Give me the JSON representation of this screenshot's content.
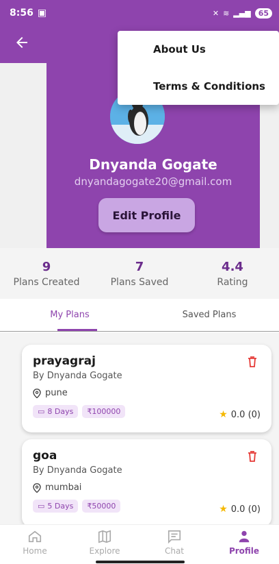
{
  "status_bar": {
    "time": "8:56",
    "battery": "65"
  },
  "profile": {
    "name": "Dnyanda Gogate",
    "email": "dnyandagogate20@gmail.com",
    "edit_label": "Edit Profile"
  },
  "menu": {
    "items": [
      {
        "label": "About Us"
      },
      {
        "label": "Terms & Conditions"
      }
    ]
  },
  "stats": [
    {
      "value": "9",
      "label": "Plans Created"
    },
    {
      "value": "7",
      "label": "Plans Saved"
    },
    {
      "value": "4.4",
      "label": "Rating"
    }
  ],
  "tabs": [
    {
      "label": "My Plans",
      "active": true
    },
    {
      "label": "Saved Plans",
      "active": false
    }
  ],
  "plans": [
    {
      "title": "prayagraj",
      "by": "By Dnyanda Gogate",
      "location": "pune",
      "days": "8 Days",
      "budget": "₹100000",
      "rating": "0.0 (0)"
    },
    {
      "title": "goa",
      "by": "By Dnyanda Gogate",
      "location": "mumbai",
      "days": "5 Days",
      "budget": "₹50000",
      "rating": "0.0 (0)"
    }
  ],
  "nav": [
    {
      "label": "Home",
      "icon": "home-icon"
    },
    {
      "label": "Explore",
      "icon": "map-icon"
    },
    {
      "label": "Chat",
      "icon": "chat-icon"
    },
    {
      "label": "Profile",
      "icon": "profile-icon",
      "active": true
    }
  ],
  "colors": {
    "primary": "#8e44ad",
    "accent_light": "#c9a6e3",
    "delete": "#e53935",
    "star": "#f5b800"
  }
}
